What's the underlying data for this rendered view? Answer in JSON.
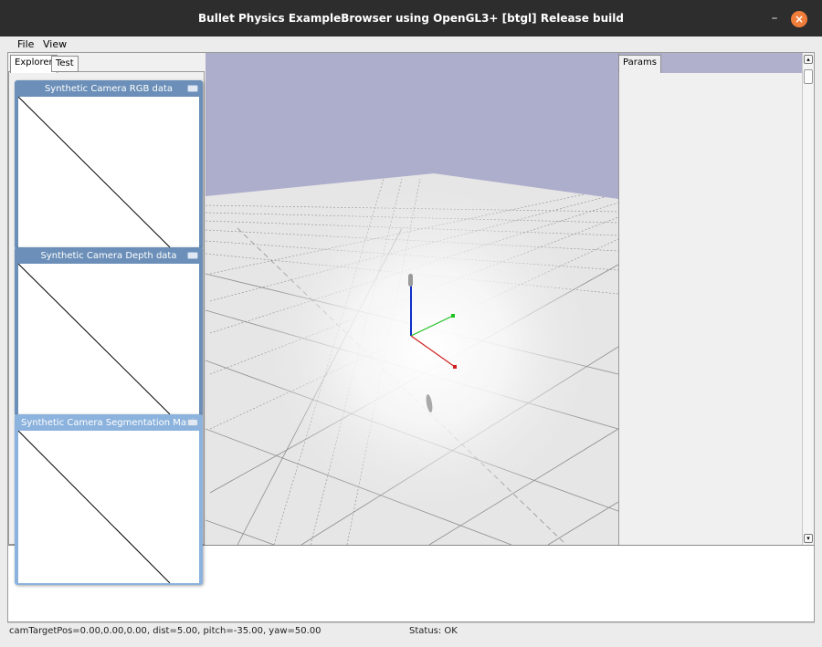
{
  "window": {
    "title": "Bullet Physics ExampleBrowser using OpenGL3+ [btgl] Release build",
    "minimize_glyph": "–",
    "close_glyph": "×",
    "close_color": "#f07d3a"
  },
  "menu": {
    "file": "File",
    "view": "View"
  },
  "left_tabs": {
    "explorer": "Explorer",
    "test": "Test"
  },
  "right_tabs": {
    "params": "Params"
  },
  "camera_windows": [
    {
      "title": "Synthetic Camera RGB data"
    },
    {
      "title": "Synthetic Camera Depth data"
    },
    {
      "title": "Synthetic Camera Segmentation Mask"
    }
  ],
  "status": {
    "camera": "camTargetPos=0.00,0.00,0.00, dist=5.00, pitch=-35.00, yaw=50.00",
    "state": "Status: OK"
  },
  "scene": {
    "sky_color": "#adadcc",
    "floor_color": "#e6e6e6",
    "axis_x_color": "#d02020",
    "axis_y_color": "#20c020",
    "axis_z_color": "#1030c8"
  }
}
